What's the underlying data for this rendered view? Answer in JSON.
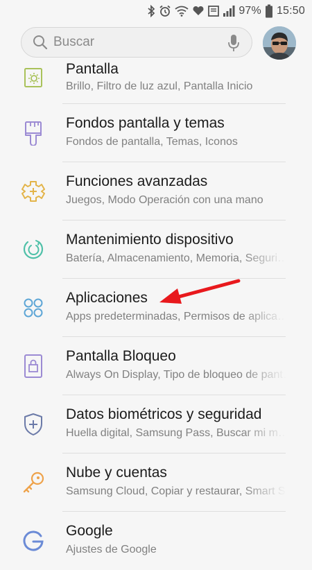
{
  "status_bar": {
    "battery_percent": "97%",
    "time": "15:50",
    "icons": [
      "bluetooth-icon",
      "alarm-icon",
      "wifi-icon",
      "data-saver-icon",
      "screenshot-icon",
      "signal-icon",
      "battery-icon"
    ]
  },
  "search": {
    "placeholder": "Buscar"
  },
  "settings": {
    "items": [
      {
        "title": "Pantalla",
        "subtitle": "Brillo, Filtro de luz azul, Pantalla Inicio",
        "icon": "display-settings-icon",
        "color": "#a9c25a"
      },
      {
        "title": "Fondos pantalla y temas",
        "subtitle": "Fondos de pantalla, Temas, Iconos",
        "icon": "paintbrush-icon",
        "color": "#9b8ad3"
      },
      {
        "title": "Funciones avanzadas",
        "subtitle": "Juegos, Modo Operación con una mano",
        "icon": "puzzle-gear-icon",
        "color": "#e3b449"
      },
      {
        "title": "Mantenimiento dispositivo",
        "subtitle": "Batería, Almacenamiento, Memoria, Seguri…",
        "icon": "device-care-icon",
        "color": "#4fc0a8"
      },
      {
        "title": "Aplicaciones",
        "subtitle": "Apps predeterminadas, Permisos de aplica…",
        "icon": "apps-grid-icon",
        "color": "#5ea6d6"
      },
      {
        "title": "Pantalla Bloqueo",
        "subtitle": "Always On Display, Tipo de bloqueo de pant…",
        "icon": "lock-screen-icon",
        "color": "#9b8ad3"
      },
      {
        "title": "Datos biométricos y seguridad",
        "subtitle": "Huella digital, Samsung Pass, Buscar mi m…",
        "icon": "shield-plus-icon",
        "color": "#6b7aa8"
      },
      {
        "title": "Nube y cuentas",
        "subtitle": "Samsung Cloud, Copiar y restaurar, Smart S…",
        "icon": "key-icon",
        "color": "#eea24a"
      },
      {
        "title": "Google",
        "subtitle": "Ajustes de Google",
        "icon": "google-g-icon",
        "color": "#6b8bd6"
      }
    ]
  },
  "annotation": {
    "arrow_color": "#e8191d",
    "points_to": "Aplicaciones"
  }
}
